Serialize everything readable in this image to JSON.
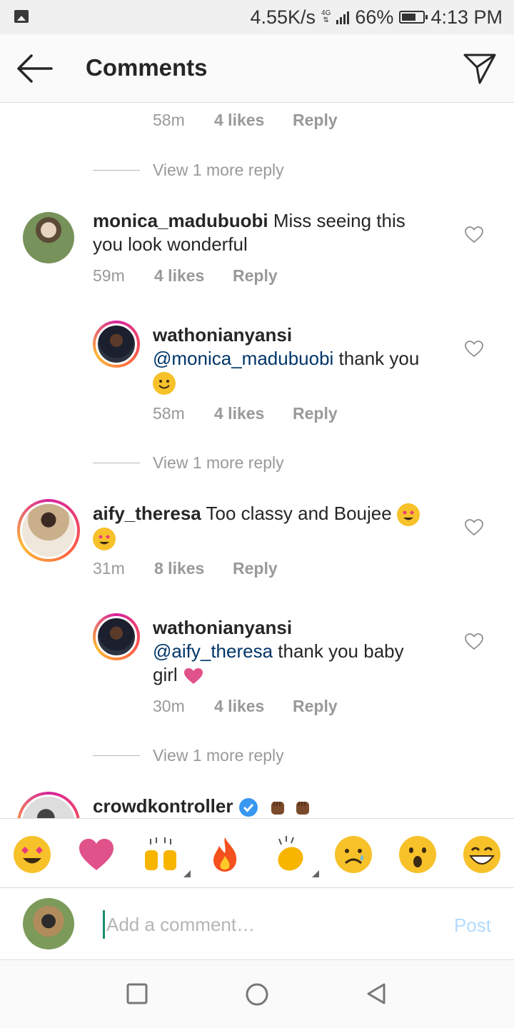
{
  "status_bar": {
    "speed": "4.55K/s",
    "network": "4G",
    "battery": "66%",
    "battery_level": 0.66,
    "time": "4:13 PM"
  },
  "header": {
    "title": "Comments"
  },
  "comments": [
    {
      "meta": {
        "time": "58m",
        "likes": "4 likes",
        "reply": "Reply"
      }
    },
    {
      "view_more": "View 1 more reply"
    },
    {
      "user": "monica_madubuobi",
      "text": "Miss seeing this",
      "text2": "you look wonderful",
      "meta": {
        "time": "59m",
        "likes": "4 likes",
        "reply": "Reply"
      }
    },
    {
      "user": "wathonianyansi",
      "mention": "@monica_madubuobi",
      "text": " thank you",
      "meta": {
        "time": "58m",
        "likes": "4 likes",
        "reply": "Reply"
      }
    },
    {
      "view_more": "View 1 more reply"
    },
    {
      "user": "aify_theresa",
      "text": " Too classy and Boujee ",
      "meta": {
        "time": "31m",
        "likes": "8 likes",
        "reply": "Reply"
      }
    },
    {
      "user": "wathonianyansi",
      "mention": "@aify_theresa",
      "text": " thank you baby",
      "text2": "girl ",
      "meta": {
        "time": "30m",
        "likes": "4 likes",
        "reply": "Reply"
      }
    },
    {
      "view_more": "View 1 more reply"
    },
    {
      "user": "crowdkontroller",
      "text": ""
    }
  ],
  "emoji_bar": [
    "heart-eyes",
    "red-heart",
    "raising-hands",
    "fire",
    "clapping-hands",
    "sad-face",
    "surprised-face",
    "grinning-face"
  ],
  "compose": {
    "placeholder": "Add a comment…",
    "post_label": "Post"
  }
}
